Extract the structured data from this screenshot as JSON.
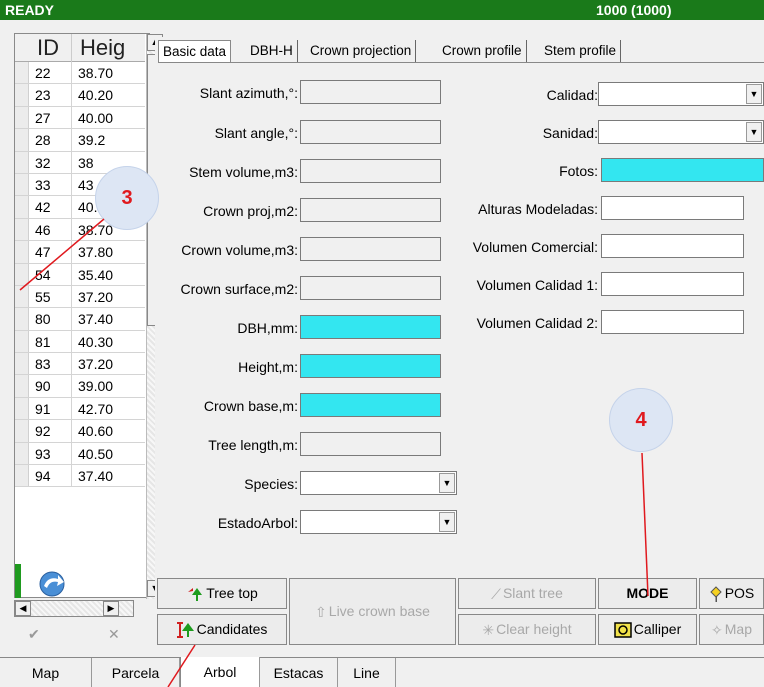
{
  "status": {
    "left": "READY",
    "right": "1000 (1000)"
  },
  "grid": {
    "col_id": "ID",
    "col_height": "Heig",
    "rows": [
      {
        "id": "22",
        "h": "38.70"
      },
      {
        "id": "23",
        "h": "40.20"
      },
      {
        "id": "27",
        "h": "40.00"
      },
      {
        "id": "28",
        "h": "39.2"
      },
      {
        "id": "32",
        "h": "38"
      },
      {
        "id": "33",
        "h": "43"
      },
      {
        "id": "42",
        "h": "40.94"
      },
      {
        "id": "46",
        "h": "38.70"
      },
      {
        "id": "47",
        "h": "37.80"
      },
      {
        "id": "54",
        "h": "35.40"
      },
      {
        "id": "55",
        "h": "37.20"
      },
      {
        "id": "80",
        "h": "37.40"
      },
      {
        "id": "81",
        "h": "40.30"
      },
      {
        "id": "83",
        "h": "37.20"
      },
      {
        "id": "90",
        "h": "39.00"
      },
      {
        "id": "91",
        "h": "42.70"
      },
      {
        "id": "92",
        "h": "40.60"
      },
      {
        "id": "93",
        "h": "40.50"
      },
      {
        "id": "94",
        "h": "37.40"
      }
    ],
    "check": "✔",
    "cancel": "✕"
  },
  "tabs": [
    "Basic data",
    "DBH-H",
    "Crown projection",
    "Crown profile",
    "Stem profile"
  ],
  "left_fields": {
    "slant_azimuth": "Slant azimuth,°:",
    "slant_angle": "Slant angle,°:",
    "stem_volume": "Stem volume,m3:",
    "crown_proj": "Crown proj,m2:",
    "crown_volume": "Crown volume,m3:",
    "crown_surface": "Crown surface,m2:",
    "dbh": "DBH,mm:",
    "height": "Height,m:",
    "crown_base": "Crown base,m:",
    "tree_length": "Tree length,m:",
    "species": "Species:",
    "estado": "EstadoArbol:"
  },
  "right_fields": {
    "calidad": "Calidad:",
    "sanidad": "Sanidad:",
    "fotos": "Fotos:",
    "alturas": "Alturas Modeladas:",
    "vol_comercial": "Volumen Comercial:",
    "vol_cal1": "Volumen Calidad 1:",
    "vol_cal2": "Volumen Calidad 2:"
  },
  "callouts": {
    "c3": "3",
    "c4": "4"
  },
  "buttons": {
    "tree_top": "Tree top",
    "candidates": "Candidates",
    "live_crown_base": "Live crown base",
    "slant_tree": "Slant tree",
    "clear_height": "Clear height",
    "mode": "MODE",
    "calliper": "Calliper",
    "pos": "POS",
    "map": "Map"
  },
  "bottom_tabs": [
    "Map",
    "Parcela",
    "Arbol",
    "Estacas",
    "Line"
  ],
  "colors": {
    "status_green": "#1a7a1a",
    "cyan_field": "#33e6f0",
    "callout_red": "#e0191e"
  }
}
